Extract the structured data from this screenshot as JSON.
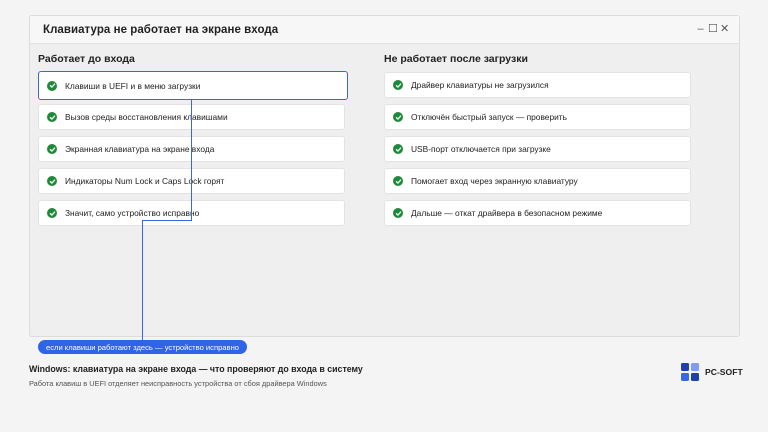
{
  "window": {
    "title": "Клавиатура не работает на экране входа",
    "controls": {
      "minimize": "–",
      "maximize": "☐",
      "close": "✕"
    }
  },
  "left_column": {
    "heading": "Работает до входа",
    "items": [
      {
        "label": "Клавиши в UEFI и в меню загрузки",
        "selected": true
      },
      {
        "label": "Вызов среды восстановления клавишами"
      },
      {
        "label": "Экранная клавиатура на экране входа"
      },
      {
        "label": "Индикаторы Num Lock и Caps Lock горят"
      },
      {
        "label": "Значит, само устройство исправно"
      }
    ]
  },
  "right_column": {
    "heading": "Не работает после загрузки",
    "items": [
      {
        "label": "Драйвер клавиатуры не загрузился"
      },
      {
        "label": "Отключён быстрый запуск — проверить"
      },
      {
        "label": "USB-порт отключается при загрузке"
      },
      {
        "label": "Помогает вход через экранную клавиатуру"
      },
      {
        "label": "Дальше — откат драйвера в безопасном режиме"
      }
    ]
  },
  "callout": {
    "text": "если клавиши работают здесь — устройство исправно"
  },
  "footer": {
    "title": "Windows: клавиатура на экране входа — что проверяют до входа в систему",
    "subtitle": "Работа клавиш в UEFI отделяет неисправность устройства от сбоя драйвера Windows"
  },
  "brand": {
    "name": "PC-SOFT",
    "colors": {
      "square_a": "#1f3fae",
      "square_b": "#7f9cf0",
      "square_c": "#3a66e6",
      "square_d": "#1f3fae"
    }
  },
  "colors": {
    "accent": "#3a66e6",
    "check": "#1f8a3a"
  }
}
